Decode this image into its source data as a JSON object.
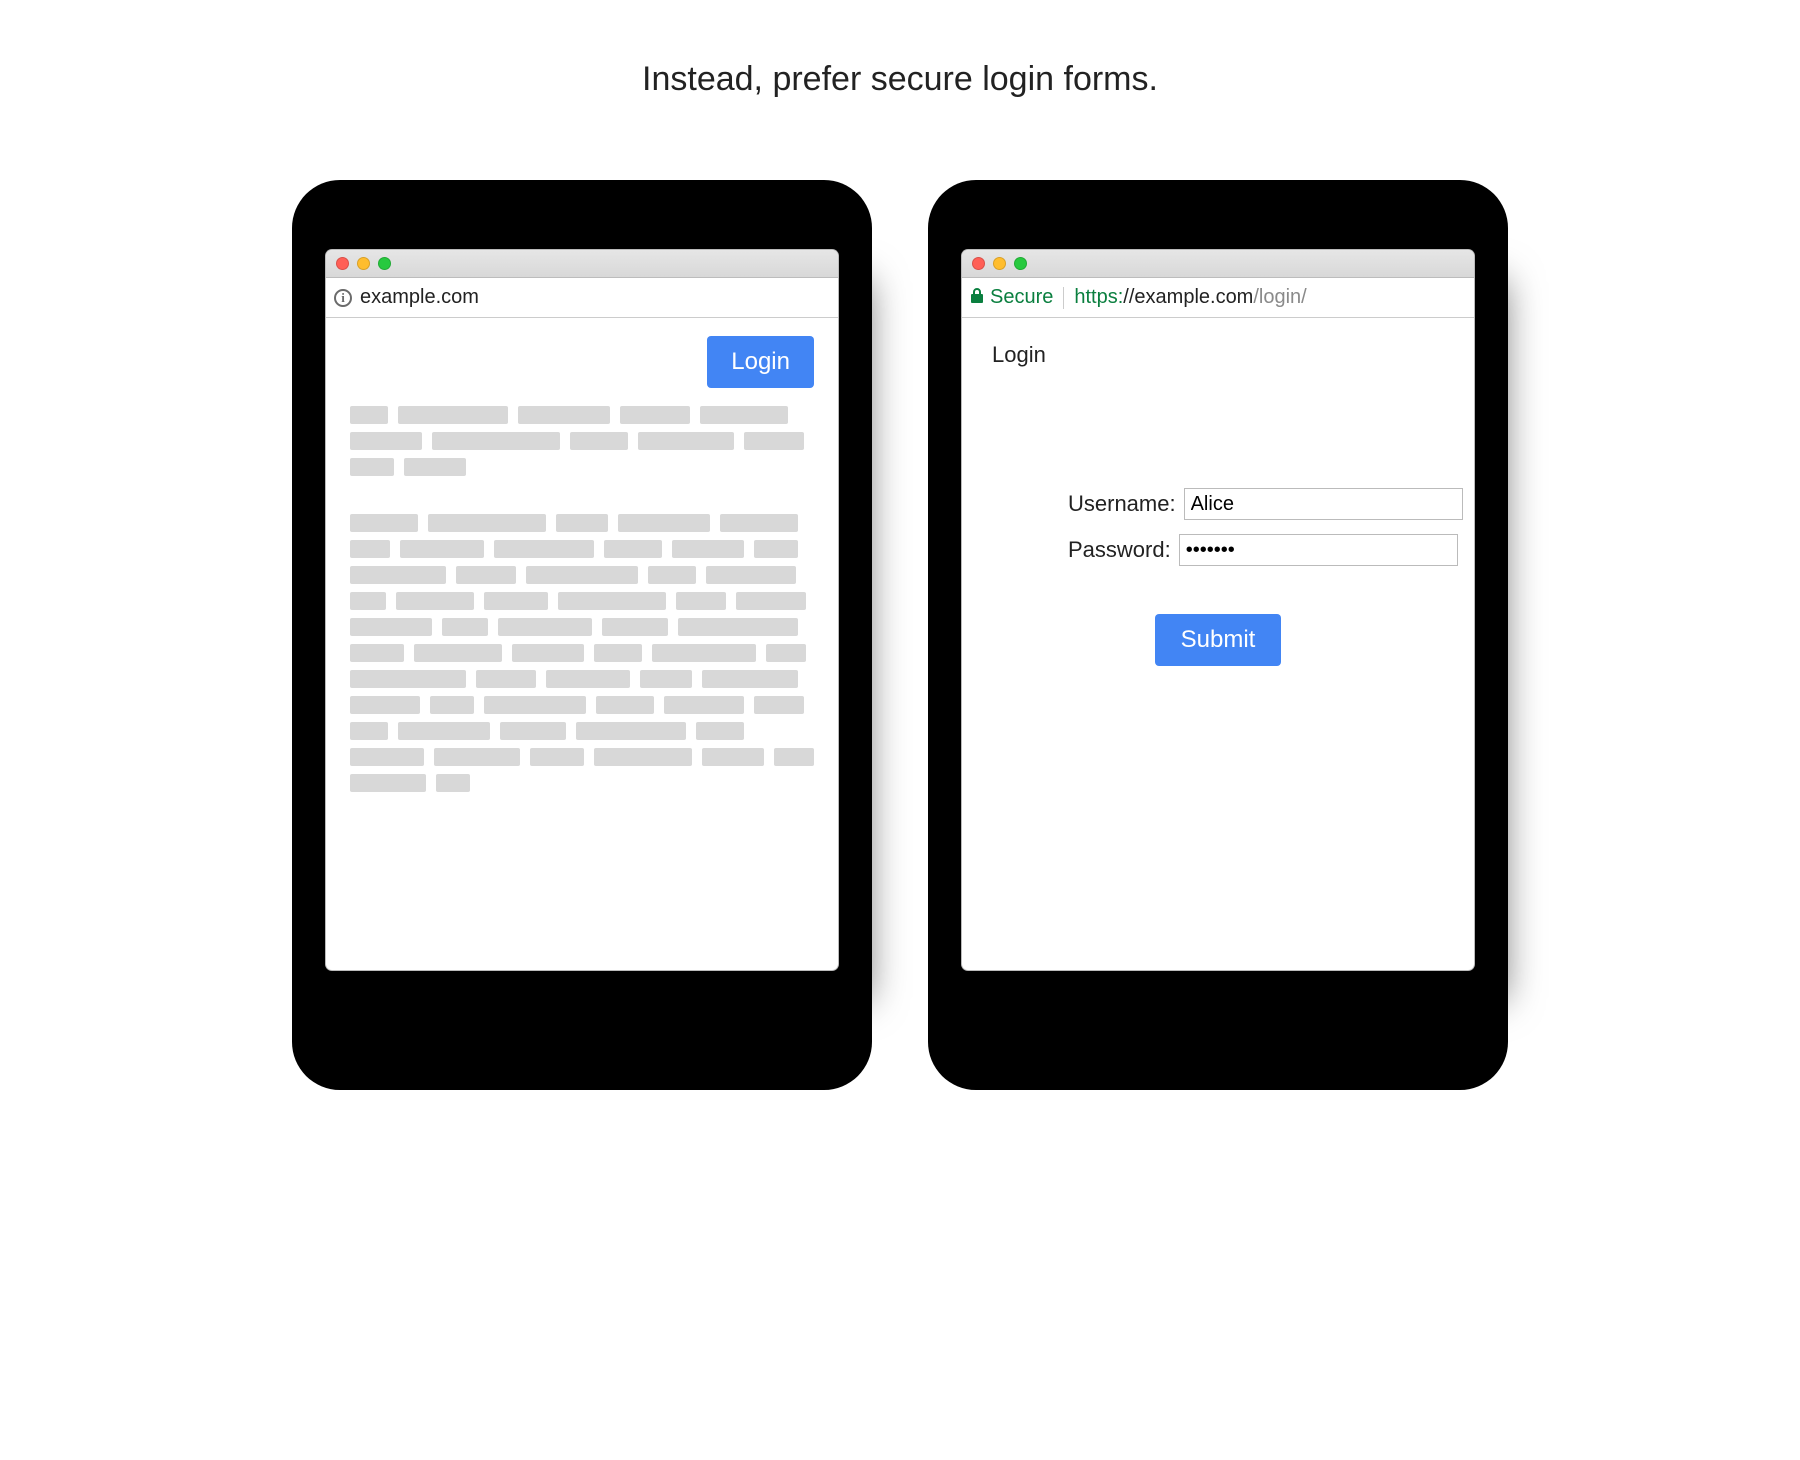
{
  "headline": "Instead, prefer secure login forms.",
  "left": {
    "address": "example.com",
    "login_button": "Login"
  },
  "right": {
    "secure_label": "Secure",
    "url_proto": "https:",
    "url_host": "//example.com",
    "url_path": "/login/",
    "title": "Login",
    "username_label": "Username:",
    "username_value": "Alice",
    "password_label": "Password:",
    "password_value": "•••••••",
    "submit_label": "Submit"
  }
}
